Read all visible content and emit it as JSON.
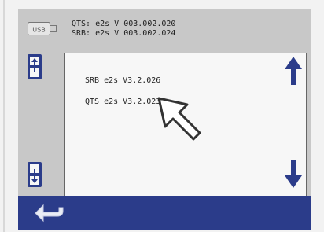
{
  "header": {
    "usb_label": "USB",
    "qts_line": "QTS: e2s V 003.002.020",
    "srb_line": "SRB: e2s V 003.002.024"
  },
  "list": {
    "items": [
      {
        "label": "SRB  e2s V3.2.026"
      },
      {
        "label": "QTS  e2s V3.2.023"
      }
    ]
  },
  "colors": {
    "footer": "#2b3c8a",
    "accent": "#2b3c8a",
    "screen_bg": "#c8c8c8"
  },
  "icons": {
    "usb": "usb-drive-icon",
    "module_top": "module-stack-icon",
    "module_bottom": "module-stack-icon",
    "up": "arrow-up-icon",
    "down": "arrow-down-icon",
    "back": "back-arrow-icon",
    "pointer": "pointer-arrow-icon"
  }
}
